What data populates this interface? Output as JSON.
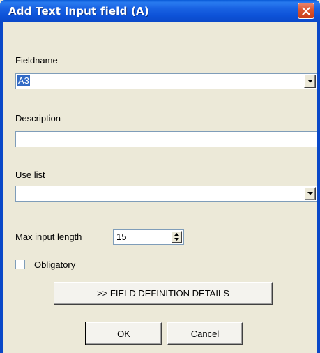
{
  "window": {
    "title": "Add Text Input field (A)"
  },
  "fieldname": {
    "label": "Fieldname",
    "value": "A3"
  },
  "description": {
    "label": "Description",
    "value": ""
  },
  "use_list": {
    "label": "Use list",
    "value": ""
  },
  "max_input_length": {
    "label": "Max input length",
    "value": "15"
  },
  "obligatory": {
    "label": "Obligatory",
    "checked": false
  },
  "buttons": {
    "details": ">> FIELD DEFINITION DETAILS",
    "ok": "OK",
    "cancel": "Cancel"
  },
  "colors": {
    "titlebar": "#0a48c8",
    "face": "#ece9d8",
    "selection": "#316ac5",
    "close": "#d9542f"
  },
  "icons": {
    "close": "close-icon",
    "dropdown": "chevron-down-icon",
    "spin_up": "arrow-up-icon",
    "spin_down": "arrow-down-icon"
  }
}
